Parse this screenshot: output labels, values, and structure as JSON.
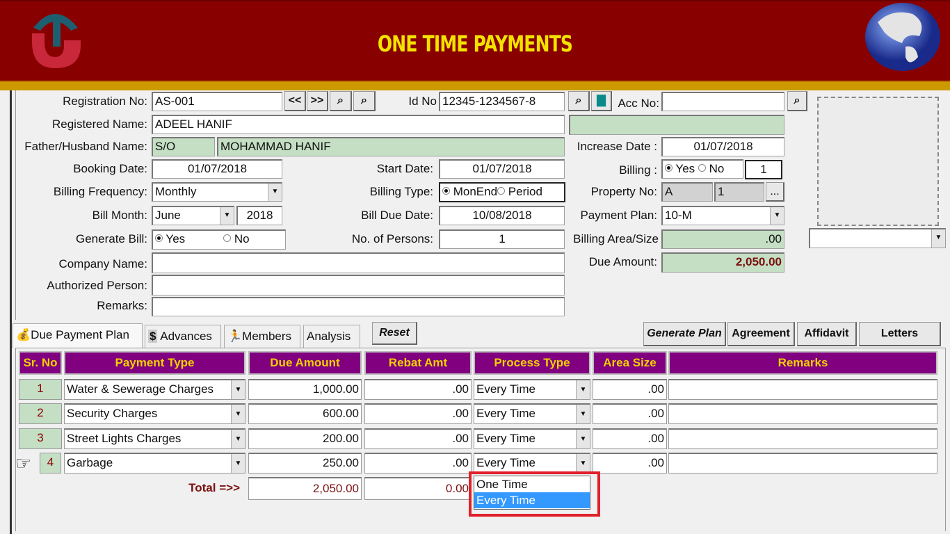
{
  "header": {
    "title": "ONE TIME PAYMENTS",
    "brand_color": "#880000",
    "accent_color": "#cc9900"
  },
  "form": {
    "registration_no": {
      "label": "Registration No:",
      "value": "AS-001"
    },
    "nav": {
      "prev": "<<",
      "next": ">>"
    },
    "id_no": {
      "label": "Id No",
      "value": "12345-1234567-8"
    },
    "acc_no": {
      "label": "Acc No:",
      "value": ""
    },
    "registered_name": {
      "label": "Registered Name:",
      "value": "ADEEL HANIF"
    },
    "father_husband": {
      "label": "Father/Husband Name:",
      "relation": "S/O",
      "value": "MOHAMMAD HANIF"
    },
    "increase_date": {
      "label": "Increase Date :",
      "value": "01/07/2018"
    },
    "booking_date": {
      "label": "Booking Date:",
      "value": "01/07/2018"
    },
    "start_date": {
      "label": "Start Date:",
      "value": "01/07/2018"
    },
    "billing": {
      "label": "Billing :",
      "yes": "Yes",
      "no": "No",
      "selected": "Yes",
      "count": "1"
    },
    "billing_frequency": {
      "label": "Billing Frequency:",
      "value": "Monthly"
    },
    "billing_type": {
      "label": "Billing Type:",
      "opt1": "MonEnd",
      "opt2": "Period",
      "selected": "MonEnd"
    },
    "property_no": {
      "label": "Property No:",
      "block": "A",
      "number": "1",
      "more": "..."
    },
    "bill_month": {
      "label": "Bill Month:",
      "month": "June",
      "year": "2018"
    },
    "bill_due_date": {
      "label": "Bill Due Date:",
      "value": "10/08/2018"
    },
    "payment_plan": {
      "label": "Payment Plan:",
      "value": "10-M"
    },
    "generate_bill": {
      "label": "Generate Bill:",
      "yes": "Yes",
      "no": "No",
      "selected": "Yes"
    },
    "no_of_persons": {
      "label": "No. of Persons:",
      "value": "1"
    },
    "billing_area": {
      "label": "Billing Area/Size",
      "value": ".00"
    },
    "company_name": {
      "label": "Company Name:",
      "value": ""
    },
    "due_amount": {
      "label": "Due Amount:",
      "value": "2,050.00"
    },
    "authorized_person": {
      "label": "Authorized Person:",
      "value": ""
    },
    "remarks": {
      "label": "Remarks:",
      "value": ""
    }
  },
  "tabs": [
    {
      "label": "Due Payment Plan",
      "icon": "money-bag-icon"
    },
    {
      "label": "Advances",
      "icon": "dollar-icon"
    },
    {
      "label": "Members",
      "icon": "running-man-icon"
    },
    {
      "label": "Analysis"
    }
  ],
  "buttons": {
    "reset": "Reset",
    "generate_plan": "Generate Plan",
    "agreement": "Agreement",
    "affidavit": "Affidavit",
    "letters": "Letters"
  },
  "grid": {
    "columns": [
      "Sr. No",
      "Payment Type",
      "Due Amount",
      "Rebat Amt",
      "Process Type",
      "Area Size",
      "Remarks"
    ],
    "rows": [
      {
        "sr": "1",
        "type": "Water & Sewerage Charges",
        "due": "1,000.00",
        "rebate": ".00",
        "process": "Every Time",
        "area": ".00",
        "remarks": ""
      },
      {
        "sr": "2",
        "type": "Security Charges",
        "due": "600.00",
        "rebate": ".00",
        "process": "Every Time",
        "area": ".00",
        "remarks": ""
      },
      {
        "sr": "3",
        "type": "Street Lights Charges",
        "due": "200.00",
        "rebate": ".00",
        "process": "Every Time",
        "area": ".00",
        "remarks": ""
      },
      {
        "sr": "4",
        "type": "Garbage",
        "due": "250.00",
        "rebate": ".00",
        "process": "Every Time",
        "area": ".00",
        "remarks": ""
      }
    ],
    "total_label": "Total =>>",
    "total_due": "2,050.00",
    "total_rebate": "0.00",
    "process_options": [
      "One Time",
      "Every Time"
    ],
    "process_highlighted": "Every Time"
  }
}
